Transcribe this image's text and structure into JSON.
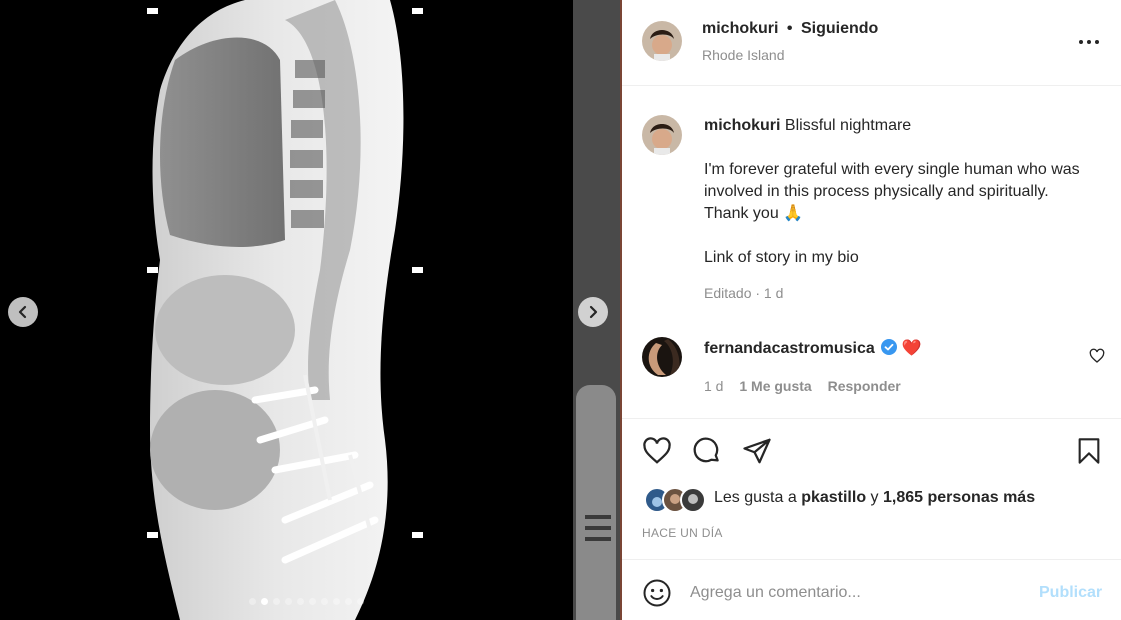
{
  "media": {
    "nav_prev_icon": "chevron-left-icon",
    "nav_next_icon": "chevron-right-icon",
    "carousel": {
      "count": 10,
      "active_index": 1
    }
  },
  "post_header": {
    "username": "michokuri",
    "separator": "•",
    "follow_status": "Siguiendo",
    "location": "Rhode Island",
    "more_icon": "more-options-icon"
  },
  "caption": {
    "username": "michokuri",
    "title": "Blissful nightmare",
    "paragraph": "I'm forever grateful with every single human who was involved in this process physically and spiritually. Thank you 🙏",
    "link_line": "Link of story in my bio",
    "meta": "Editado · 1 d"
  },
  "comment": {
    "username": "fernandacastromusica",
    "text": "❤️",
    "time": "1 d",
    "likes": "1 Me gusta",
    "reply": "Responder"
  },
  "actions": {
    "like_icon": "heart-icon",
    "comment_icon": "comment-icon",
    "share_icon": "send-icon",
    "save_icon": "bookmark-icon"
  },
  "likes": {
    "prefix": "Les gusta a",
    "user": "pkastillo",
    "joiner": "y",
    "others": "1,865 personas más"
  },
  "timestamp": "HACE UN DÍA",
  "comment_box": {
    "emoji_icon": "emoji-icon",
    "placeholder": "Agrega un comentario...",
    "submit_label": "Publicar"
  },
  "colors": {
    "accent_blue": "#b2dffc",
    "verified_blue": "#3897f0",
    "heart_red": "#ed4956"
  }
}
